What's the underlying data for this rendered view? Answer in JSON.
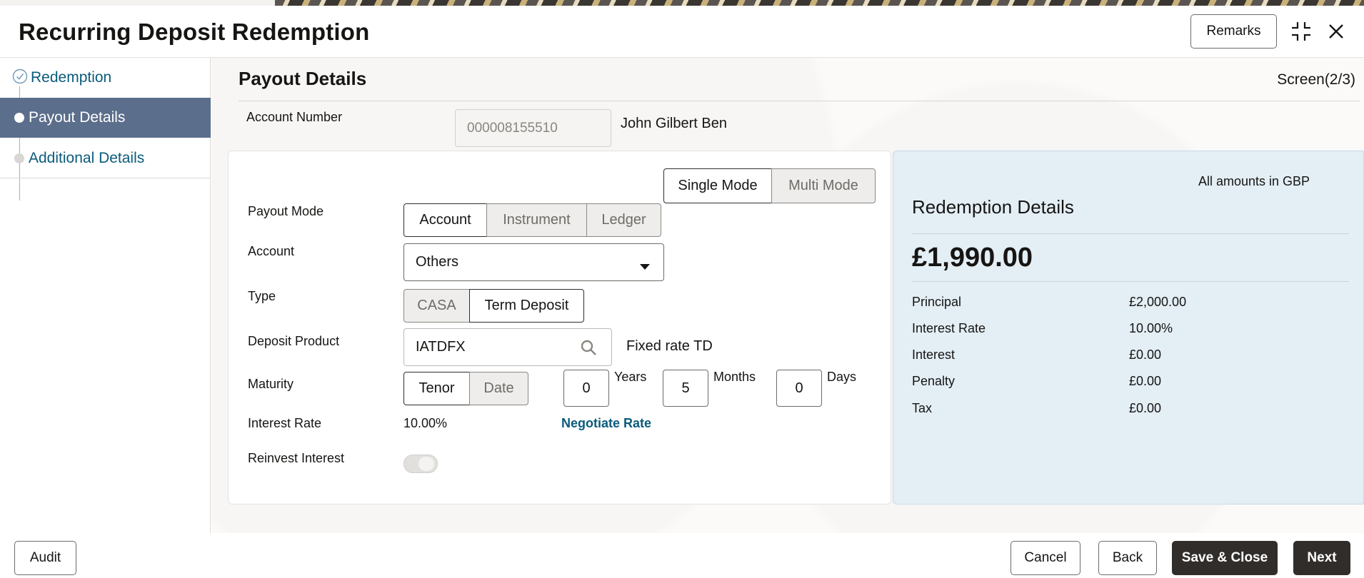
{
  "window": {
    "title": "Recurring Deposit Redemption",
    "remarks_label": "Remarks"
  },
  "steps": [
    {
      "label": "Redemption",
      "state": "completed"
    },
    {
      "label": "Payout Details",
      "state": "active"
    },
    {
      "label": "Additional Details",
      "state": "pending"
    }
  ],
  "main": {
    "section_title": "Payout Details",
    "screen_count": "Screen(2/3)",
    "account_number_label": "Account Number",
    "account_number_value": "000008155510",
    "account_holder": "John Gilbert Ben"
  },
  "payout": {
    "mode_toggle": [
      "Single Mode",
      "Multi Mode"
    ],
    "payout_mode_label": "Payout Mode",
    "payout_mode_options": [
      "Account",
      "Instrument",
      "Ledger"
    ],
    "account_label": "Account",
    "account_value": "Others",
    "type_label": "Type",
    "type_options": [
      "CASA",
      "Term Deposit"
    ],
    "deposit_product_label": "Deposit Product",
    "deposit_product_value": "IATDFX",
    "deposit_product_desc": "Fixed rate TD",
    "maturity_label": "Maturity",
    "maturity_options": [
      "Tenor",
      "Date"
    ],
    "years_value": "0",
    "years_label": "Years",
    "months_value": "5",
    "months_label": "Months",
    "days_value": "0",
    "days_label": "Days",
    "interest_rate_label": "Interest Rate",
    "interest_rate_value": "10.00%",
    "negotiate_rate_label": "Negotiate Rate",
    "reinvest_interest_label": "Reinvest Interest",
    "reinvest_interest_on": false
  },
  "redemption": {
    "currency_note": "All amounts in GBP",
    "title": "Redemption Details",
    "total": "£1,990.00",
    "rows": [
      {
        "label": "Principal",
        "value": "£2,000.00"
      },
      {
        "label": "Interest Rate",
        "value": "10.00%"
      },
      {
        "label": "Interest",
        "value": "£0.00"
      },
      {
        "label": "Penalty",
        "value": "£0.00"
      },
      {
        "label": "Tax",
        "value": "£0.00"
      }
    ]
  },
  "footer": {
    "audit": "Audit",
    "cancel": "Cancel",
    "back": "Back",
    "save_close": "Save & Close",
    "next": "Next"
  },
  "colors": {
    "link": "#0a5b7b",
    "active_step_bg": "#5b6e8b",
    "primary_button": "#312d2a",
    "summary_panel": "#e3eef5"
  },
  "icons": {
    "maximize": "collapse-corners-icon",
    "close": "close-icon",
    "dropdown": "chevron-down-icon",
    "search": "search-icon",
    "completed_step": "check-circle-icon"
  }
}
